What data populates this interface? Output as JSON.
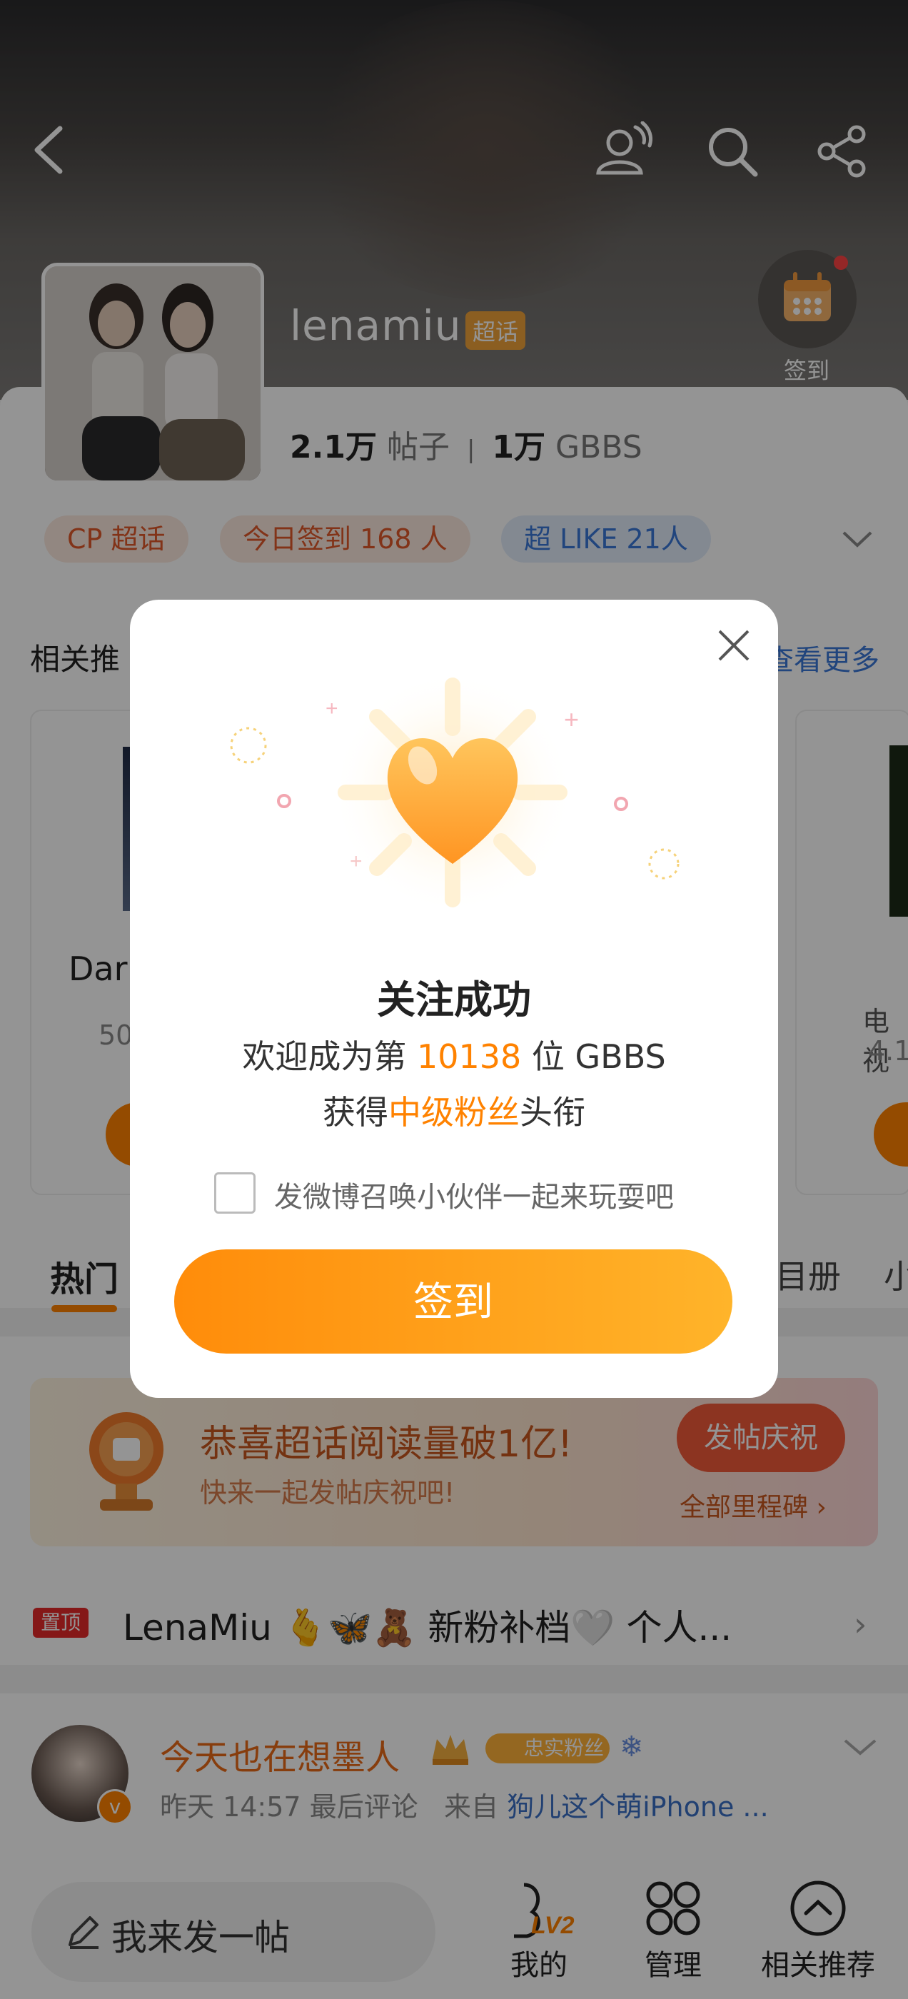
{
  "header": {
    "name": "lenamiu",
    "badge": "超话",
    "checkin_label": "签到",
    "posts_count": "2.1万",
    "posts_label": "帖子",
    "fans_count": "1万",
    "fans_label": "GBBS",
    "pills": [
      "CP 超话",
      "今日签到 168 人",
      "超 LIKE 21人"
    ]
  },
  "related": {
    "title": "相关推",
    "more": "查看更多",
    "left_card_title": "Dar",
    "left_card_sub": "50",
    "right_card_title": "电视",
    "right_card_sub": "4.1"
  },
  "tabs": {
    "hot": "热门",
    "right1": "目册",
    "right2": "小"
  },
  "banner": {
    "title": "恭喜超话阅读量破1亿!",
    "subtitle": "快来一起发帖庆祝吧!",
    "action": "发帖庆祝",
    "milestone": "全部里程碑"
  },
  "pinned": {
    "tag": "置顶",
    "text": "LenaMiu 🫰🦋🧸 新粉补档🤍 个人..."
  },
  "post": {
    "author": "今天也在想墨人",
    "fan_badge": "忠实粉丝",
    "meta_time": "昨天 14:57",
    "meta_comment": "最后评论",
    "meta_from": "来自",
    "meta_device": "狗儿这个萌iPhone ..."
  },
  "modal": {
    "title": "关注成功",
    "line1_prefix": "欢迎成为第 ",
    "line1_number": "10138",
    "line1_suffix": " 位 GBBS",
    "line2_prefix": "获得",
    "line2_highlight": "中级粉丝",
    "line2_suffix": "头衔",
    "checkbox_label": "发微博召唤小伙伴一起来玩耍吧",
    "button": "签到"
  },
  "bottom": {
    "post_button": "我来发一帖",
    "level": "LV2",
    "mine": "我的",
    "manage": "管理",
    "related": "相关推荐"
  },
  "colors": {
    "accent": "#ff8200",
    "blue_pill": "#3a77d8"
  }
}
